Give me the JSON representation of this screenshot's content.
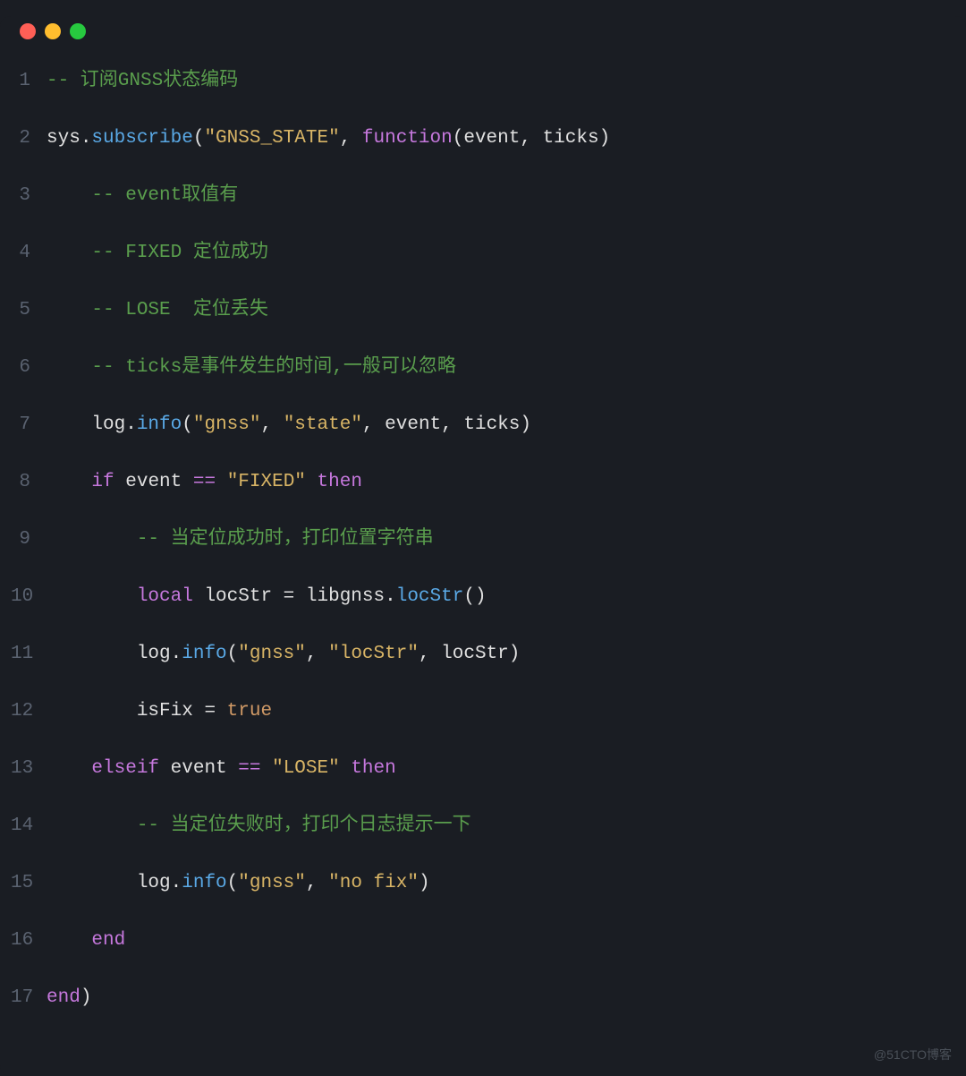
{
  "colors": {
    "background": "#1a1d23",
    "traffic_red": "#ff5f56",
    "traffic_yellow": "#ffbd2e",
    "traffic_green": "#27c93f",
    "comment": "#5a9e4d",
    "method": "#5aa9e6",
    "string": "#d9b566",
    "keyword": "#c678dd",
    "identifier": "#e0e0e0",
    "bool": "#d19a66",
    "linenum": "#5a6270"
  },
  "watermark": "@51CTO博客",
  "code": {
    "language": "lua",
    "lines": [
      {
        "n": "1",
        "tokens": [
          {
            "cls": "tok-comment",
            "t": "-- 订阅GNSS状态编码"
          }
        ]
      },
      {
        "n": "2",
        "tokens": [
          {
            "cls": "tok-ident",
            "t": "sys"
          },
          {
            "cls": "tok-dot",
            "t": "."
          },
          {
            "cls": "tok-method",
            "t": "subscribe"
          },
          {
            "cls": "tok-paren",
            "t": "("
          },
          {
            "cls": "tok-string",
            "t": "\"GNSS_STATE\""
          },
          {
            "cls": "tok-comma",
            "t": ", "
          },
          {
            "cls": "tok-keyword",
            "t": "function"
          },
          {
            "cls": "tok-paren",
            "t": "("
          },
          {
            "cls": "tok-ident",
            "t": "event"
          },
          {
            "cls": "tok-comma",
            "t": ", "
          },
          {
            "cls": "tok-ident",
            "t": "ticks"
          },
          {
            "cls": "tok-paren",
            "t": ")"
          }
        ]
      },
      {
        "n": "3",
        "tokens": [
          {
            "cls": "tok-ident",
            "t": "    "
          },
          {
            "cls": "tok-comment",
            "t": "-- event取值有"
          }
        ]
      },
      {
        "n": "4",
        "tokens": [
          {
            "cls": "tok-ident",
            "t": "    "
          },
          {
            "cls": "tok-comment",
            "t": "-- FIXED 定位成功"
          }
        ]
      },
      {
        "n": "5",
        "tokens": [
          {
            "cls": "tok-ident",
            "t": "    "
          },
          {
            "cls": "tok-comment",
            "t": "-- LOSE  定位丢失"
          }
        ]
      },
      {
        "n": "6",
        "tokens": [
          {
            "cls": "tok-ident",
            "t": "    "
          },
          {
            "cls": "tok-comment",
            "t": "-- ticks是事件发生的时间,一般可以忽略"
          }
        ]
      },
      {
        "n": "7",
        "tokens": [
          {
            "cls": "tok-ident",
            "t": "    log"
          },
          {
            "cls": "tok-dot",
            "t": "."
          },
          {
            "cls": "tok-method",
            "t": "info"
          },
          {
            "cls": "tok-paren",
            "t": "("
          },
          {
            "cls": "tok-string",
            "t": "\"gnss\""
          },
          {
            "cls": "tok-comma",
            "t": ", "
          },
          {
            "cls": "tok-string",
            "t": "\"state\""
          },
          {
            "cls": "tok-comma",
            "t": ", "
          },
          {
            "cls": "tok-ident",
            "t": "event"
          },
          {
            "cls": "tok-comma",
            "t": ", "
          },
          {
            "cls": "tok-ident",
            "t": "ticks"
          },
          {
            "cls": "tok-paren",
            "t": ")"
          }
        ]
      },
      {
        "n": "8",
        "tokens": [
          {
            "cls": "tok-ident",
            "t": "    "
          },
          {
            "cls": "tok-keyword",
            "t": "if"
          },
          {
            "cls": "tok-ident",
            "t": " event "
          },
          {
            "cls": "tok-op",
            "t": "=="
          },
          {
            "cls": "tok-ident",
            "t": " "
          },
          {
            "cls": "tok-string",
            "t": "\"FIXED\""
          },
          {
            "cls": "tok-ident",
            "t": " "
          },
          {
            "cls": "tok-keyword",
            "t": "then"
          }
        ]
      },
      {
        "n": "9",
        "tokens": [
          {
            "cls": "tok-ident",
            "t": "        "
          },
          {
            "cls": "tok-comment",
            "t": "-- 当定位成功时，打印位置字符串"
          }
        ]
      },
      {
        "n": "10",
        "tokens": [
          {
            "cls": "tok-ident",
            "t": "        "
          },
          {
            "cls": "tok-keyword",
            "t": "local"
          },
          {
            "cls": "tok-ident",
            "t": " locStr "
          },
          {
            "cls": "tok-eq",
            "t": "="
          },
          {
            "cls": "tok-ident",
            "t": " libgnss"
          },
          {
            "cls": "tok-dot",
            "t": "."
          },
          {
            "cls": "tok-method",
            "t": "locStr"
          },
          {
            "cls": "tok-paren",
            "t": "()"
          }
        ]
      },
      {
        "n": "11",
        "tokens": [
          {
            "cls": "tok-ident",
            "t": "        log"
          },
          {
            "cls": "tok-dot",
            "t": "."
          },
          {
            "cls": "tok-method",
            "t": "info"
          },
          {
            "cls": "tok-paren",
            "t": "("
          },
          {
            "cls": "tok-string",
            "t": "\"gnss\""
          },
          {
            "cls": "tok-comma",
            "t": ", "
          },
          {
            "cls": "tok-string",
            "t": "\"locStr\""
          },
          {
            "cls": "tok-comma",
            "t": ", "
          },
          {
            "cls": "tok-ident",
            "t": "locStr"
          },
          {
            "cls": "tok-paren",
            "t": ")"
          }
        ]
      },
      {
        "n": "12",
        "tokens": [
          {
            "cls": "tok-ident",
            "t": "        isFix "
          },
          {
            "cls": "tok-eq",
            "t": "="
          },
          {
            "cls": "tok-ident",
            "t": " "
          },
          {
            "cls": "tok-bool",
            "t": "true"
          }
        ]
      },
      {
        "n": "13",
        "tokens": [
          {
            "cls": "tok-ident",
            "t": "    "
          },
          {
            "cls": "tok-keyword",
            "t": "elseif"
          },
          {
            "cls": "tok-ident",
            "t": " event "
          },
          {
            "cls": "tok-op",
            "t": "=="
          },
          {
            "cls": "tok-ident",
            "t": " "
          },
          {
            "cls": "tok-string",
            "t": "\"LOSE\""
          },
          {
            "cls": "tok-ident",
            "t": " "
          },
          {
            "cls": "tok-keyword",
            "t": "then"
          }
        ]
      },
      {
        "n": "14",
        "tokens": [
          {
            "cls": "tok-ident",
            "t": "        "
          },
          {
            "cls": "tok-comment",
            "t": "-- 当定位失败时，打印个日志提示一下"
          }
        ]
      },
      {
        "n": "15",
        "tokens": [
          {
            "cls": "tok-ident",
            "t": "        log"
          },
          {
            "cls": "tok-dot",
            "t": "."
          },
          {
            "cls": "tok-method",
            "t": "info"
          },
          {
            "cls": "tok-paren",
            "t": "("
          },
          {
            "cls": "tok-string",
            "t": "\"gnss\""
          },
          {
            "cls": "tok-comma",
            "t": ", "
          },
          {
            "cls": "tok-string",
            "t": "\"no fix\""
          },
          {
            "cls": "tok-paren",
            "t": ")"
          }
        ]
      },
      {
        "n": "16",
        "tokens": [
          {
            "cls": "tok-ident",
            "t": "    "
          },
          {
            "cls": "tok-keyword",
            "t": "end"
          }
        ]
      },
      {
        "n": "17",
        "tokens": [
          {
            "cls": "tok-keyword",
            "t": "end"
          },
          {
            "cls": "tok-paren",
            "t": ")"
          }
        ]
      }
    ]
  }
}
